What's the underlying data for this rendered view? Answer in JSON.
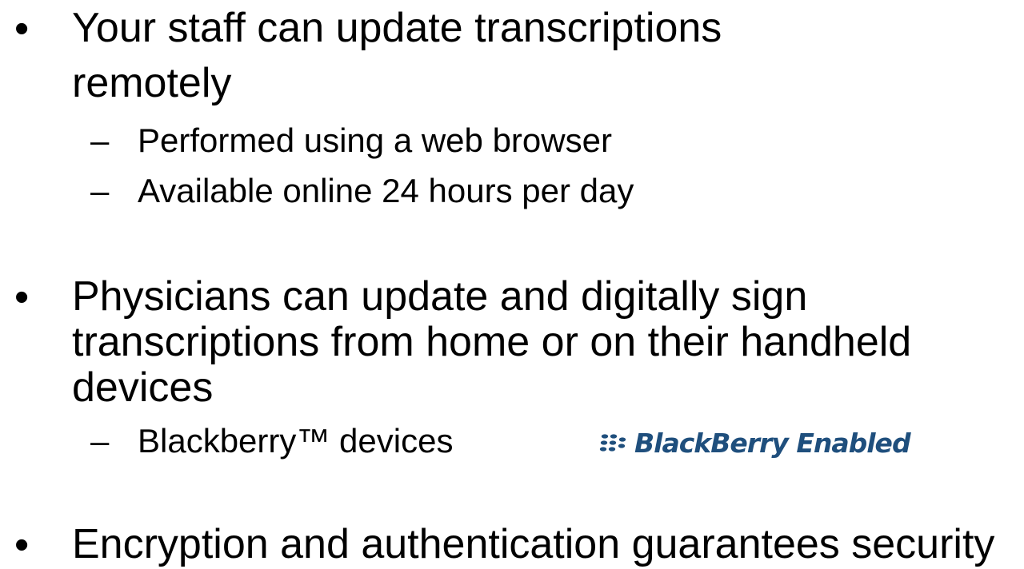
{
  "bullets": [
    {
      "symbol": "•",
      "lines": [
        "Your staff can update transcriptions",
        "remotely"
      ],
      "subitems": [
        {
          "symbol": "–",
          "text": "Performed using a web browser"
        },
        {
          "symbol": "–",
          "text": "Available online 24 hours per day"
        }
      ]
    },
    {
      "symbol": "•",
      "lines": [
        "Physicians can update and digitally sign",
        "transcriptions from home or on their handheld",
        "devices"
      ],
      "subitems": [
        {
          "symbol": "–",
          "text": "Blackberry™ devices"
        }
      ]
    },
    {
      "symbol": "•",
      "lines": [
        "Encryption and authentication guarantees security"
      ],
      "subitems": []
    }
  ],
  "logo": {
    "text": "BlackBerry Enabled",
    "icon": "blackberry-logo-icon",
    "color": "#1f4f7d"
  }
}
